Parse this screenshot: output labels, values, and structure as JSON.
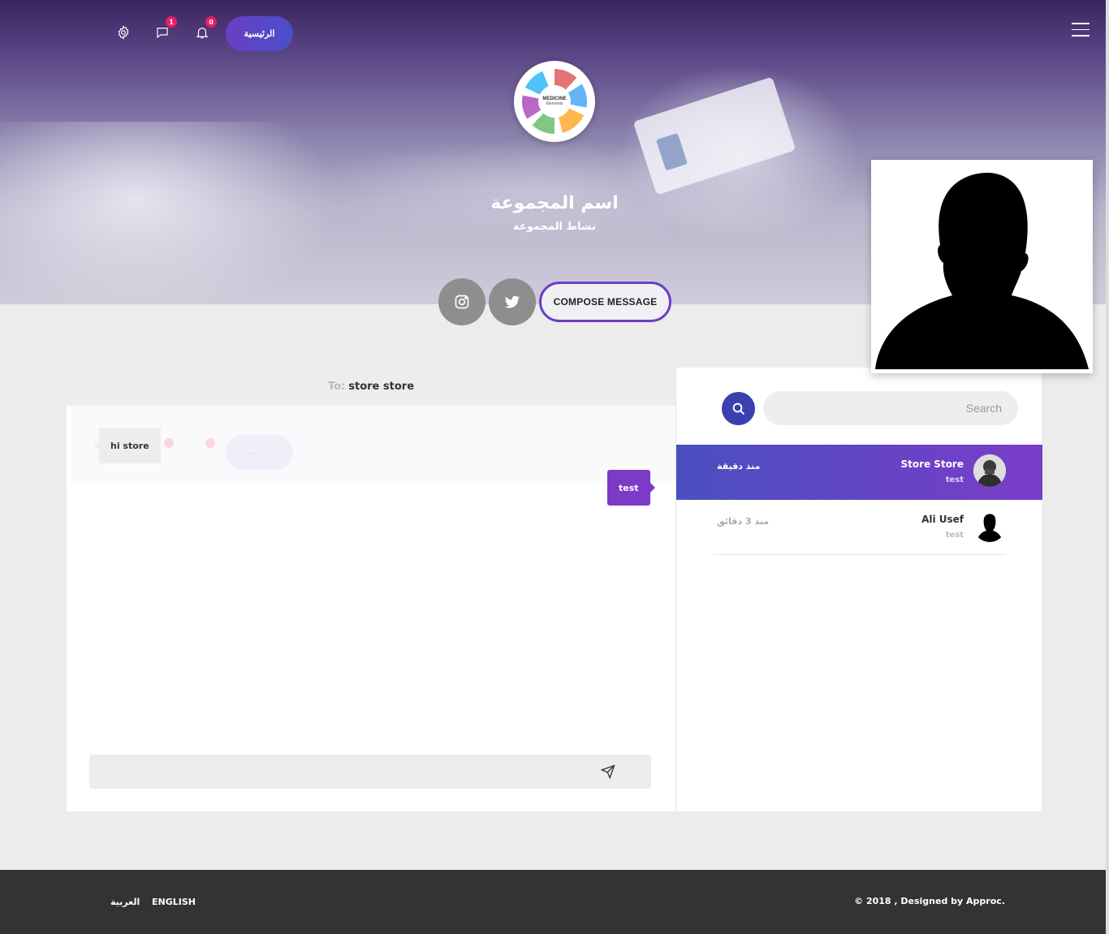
{
  "header": {
    "home_label": "الرئيسية",
    "messages_badge": "1",
    "notifications_badge": "0"
  },
  "group": {
    "logo_title": "MEDICINE",
    "logo_subtitle": "Elements",
    "name": "اسم المجموعة",
    "activity": "نشاط المجموعة"
  },
  "actions": {
    "compose_label": "COMPOSE MESSAGE"
  },
  "chat": {
    "to_label": "To:",
    "to_name": "store store",
    "messages": [
      {
        "direction": "in",
        "text": "hi store"
      },
      {
        "direction": "out",
        "text": "test"
      }
    ],
    "input_placeholder": ""
  },
  "sidebar": {
    "search_placeholder": "Search",
    "conversations": [
      {
        "name": "Store Store",
        "preview": "test",
        "time": "منذ دقيقة",
        "active": true
      },
      {
        "name": "Ali Usef",
        "preview": "test",
        "time": "منذ 3 دقائق",
        "active": false
      }
    ]
  },
  "footer": {
    "lang_ar": "العربية",
    "lang_en": "ENGLISH",
    "copyright": "© 2018 , Designed by Approc."
  },
  "colors": {
    "accent": "#6a3fc6",
    "accent_blue": "#3b3fb0",
    "badge": "#e91e63",
    "footer_bg": "#333333"
  }
}
